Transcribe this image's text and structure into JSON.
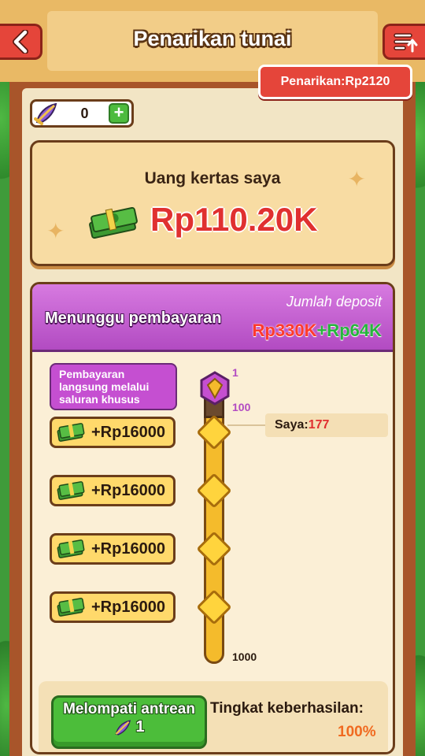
{
  "header": {
    "title": "Penarikan tunai",
    "withdraw_badge": "Penarikan:Rp2120"
  },
  "tickets": {
    "count": "0",
    "plus": "+"
  },
  "wallet": {
    "title": "Uang kertas saya",
    "amount": "Rp110.20K"
  },
  "payment": {
    "title": "Menunggu pembayaran",
    "deposit_label": "Jumlah deposit",
    "deposit_red": "Rp330K",
    "deposit_green": "+Rp64K",
    "special_channel": "Pembayaran langsung melalui saluran khusus",
    "tick_1": "1",
    "tick_100": "100",
    "tick_1000": "1000",
    "me_label": "Saya:",
    "me_value": "177",
    "rewards": [
      {
        "label": "+Rp16000"
      },
      {
        "label": "+Rp16000"
      },
      {
        "label": "+Rp16000"
      },
      {
        "label": "+Rp16000"
      }
    ]
  },
  "skip": {
    "label": "Melompati antrean",
    "cost": "1"
  },
  "success": {
    "label": "Tingkat keberhasilan:",
    "value": "100%"
  },
  "colors": {
    "accent_red": "#e5453a",
    "money_red": "#e03030",
    "purple": "#b24bc2",
    "green": "#4cbd3a",
    "gold": "#f4bb2c"
  },
  "icons": {
    "back": "chevron-left-icon",
    "history": "list-upload-icon",
    "ticket": "feather-ticket-icon",
    "cash": "cash-stack-icon"
  }
}
